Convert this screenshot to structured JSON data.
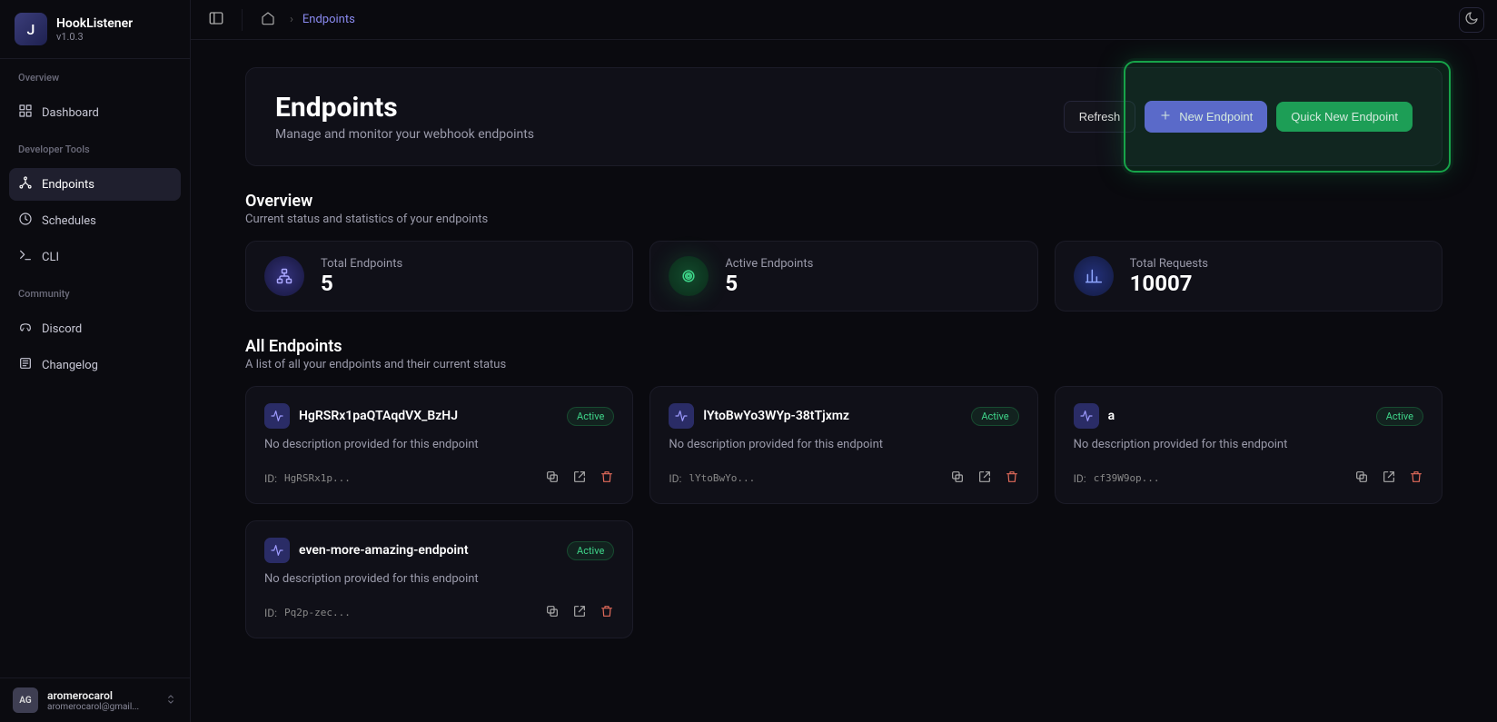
{
  "app": {
    "name": "HookListener",
    "version": "v1.0.3",
    "logo_letter": "J"
  },
  "nav": {
    "sections": [
      {
        "heading": "Overview",
        "items": [
          {
            "icon": "dashboard",
            "label": "Dashboard",
            "active": false
          }
        ]
      },
      {
        "heading": "Developer Tools",
        "items": [
          {
            "icon": "endpoints",
            "label": "Endpoints",
            "active": true
          },
          {
            "icon": "schedules",
            "label": "Schedules",
            "active": false
          },
          {
            "icon": "cli",
            "label": "CLI",
            "active": false
          }
        ]
      },
      {
        "heading": "Community",
        "items": [
          {
            "icon": "discord",
            "label": "Discord",
            "active": false
          },
          {
            "icon": "changelog",
            "label": "Changelog",
            "active": false
          }
        ]
      }
    ]
  },
  "user": {
    "initials": "AG",
    "name": "aromerocarol",
    "email": "aromerocarol@gmail..."
  },
  "breadcrumb": {
    "current": "Endpoints"
  },
  "page": {
    "title": "Endpoints",
    "subtitle": "Manage and monitor your webhook endpoints",
    "actions": {
      "refresh": "Refresh",
      "new": "New Endpoint",
      "quick": "Quick New Endpoint"
    }
  },
  "overview": {
    "title": "Overview",
    "subtitle": "Current status and statistics of your endpoints",
    "stats": [
      {
        "label": "Total Endpoints",
        "value": "5",
        "variant": "purple",
        "icon": "sitemap"
      },
      {
        "label": "Active Endpoints",
        "value": "5",
        "variant": "green",
        "icon": "broadcast"
      },
      {
        "label": "Total Requests",
        "value": "10007",
        "variant": "blue",
        "icon": "barchart"
      }
    ]
  },
  "list": {
    "title": "All Endpoints",
    "subtitle": "A list of all your endpoints and their current status",
    "id_prefix": "ID: ",
    "items": [
      {
        "name": "HgRSRx1paQTAqdVX_BzHJ",
        "desc": "No description provided for this endpoint",
        "status": "Active",
        "id": "HgRSRx1p..."
      },
      {
        "name": "lYtoBwYo3WYp-38tTjxmz",
        "desc": "No description provided for this endpoint",
        "status": "Active",
        "id": "lYtoBwYo..."
      },
      {
        "name": "a",
        "desc": "No description provided for this endpoint",
        "status": "Active",
        "id": "cf39W9op..."
      },
      {
        "name": "even-more-amazing-endpoint",
        "desc": "No description provided for this endpoint",
        "status": "Active",
        "id": "Pq2p-zec..."
      }
    ]
  }
}
